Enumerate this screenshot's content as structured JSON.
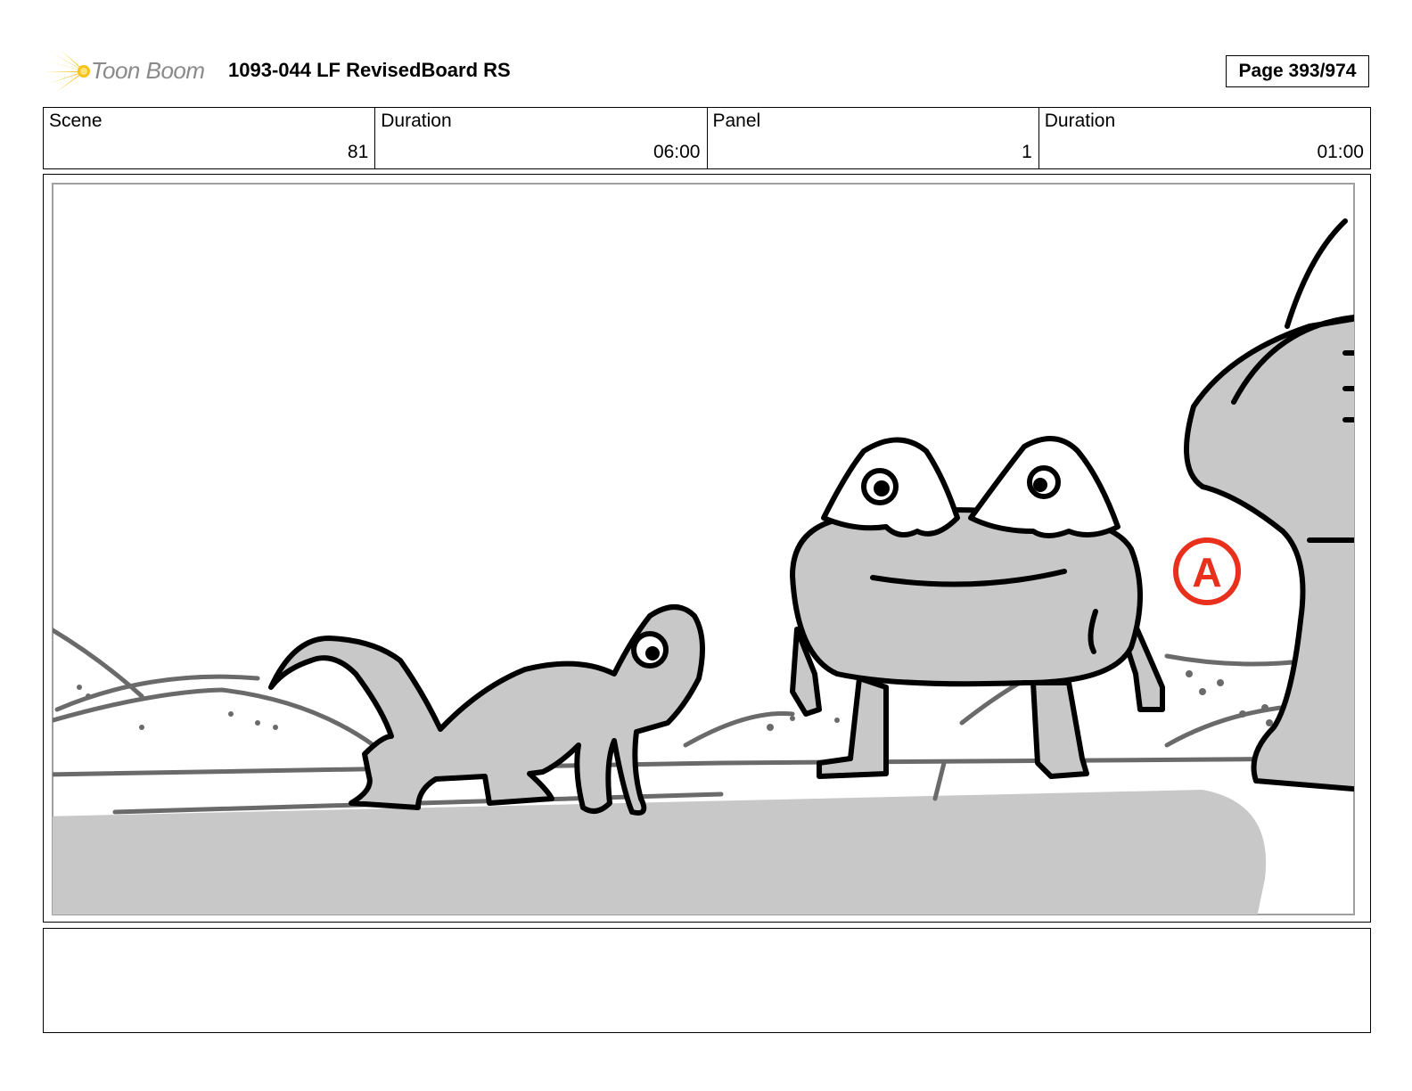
{
  "header": {
    "logo_text": "Toon Boom",
    "title": "1093-044 LF RevisedBoard RS",
    "page_label": "Page 393/974"
  },
  "info": {
    "scene_label": "Scene",
    "scene_value": "81",
    "scene_duration_label": "Duration",
    "scene_duration_value": "06:00",
    "panel_label": "Panel",
    "panel_value": "1",
    "panel_duration_label": "Duration",
    "panel_duration_value": "01:00"
  },
  "panel": {
    "annotation_mark": "A",
    "annotation_color": "#e8301c",
    "sketch_fill": "#c8c8c8",
    "line_color": "#000000"
  },
  "notes": {
    "text": ""
  }
}
